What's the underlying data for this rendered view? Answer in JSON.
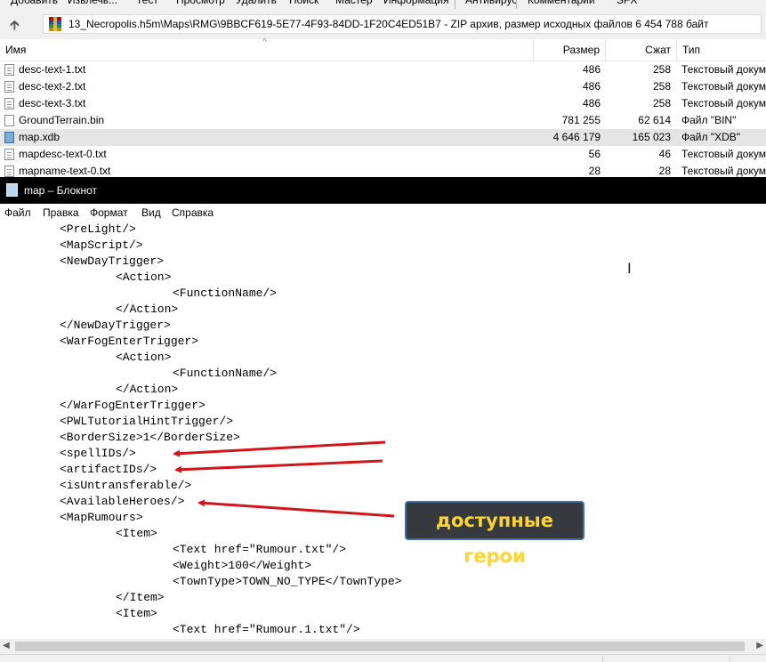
{
  "archiver": {
    "toolbar": [
      "Добавить",
      "Извлечь...",
      "Тест",
      "Просмотр",
      "Удалить",
      "Поиск",
      "Мастер",
      "Информация",
      "Антивирус",
      "Комментарий",
      "SFX"
    ],
    "address": "13_Necropolis.h5m\\Maps\\RMG\\9BBCF619-5E77-4F93-84DD-1F20C4ED51B7 - ZIP архив, размер исходных файлов 6 454 788 байт",
    "up_icon": "up-arrow-icon",
    "columns": {
      "name": "Имя",
      "size": "Размер",
      "packed": "Сжат",
      "type": "Тип"
    },
    "files": [
      {
        "name": "desc-text-1.txt",
        "size": "486",
        "packed": "258",
        "type": "Текстовый докум",
        "icon": "text-file-icon"
      },
      {
        "name": "desc-text-2.txt",
        "size": "486",
        "packed": "258",
        "type": "Текстовый докум",
        "icon": "text-file-icon"
      },
      {
        "name": "desc-text-3.txt",
        "size": "486",
        "packed": "258",
        "type": "Текстовый докум",
        "icon": "text-file-icon"
      },
      {
        "name": "GroundTerrain.bin",
        "size": "781 255",
        "packed": "62 614",
        "type": "Файл \"BIN\"",
        "icon": "file-icon"
      },
      {
        "name": "map.xdb",
        "size": "4 646 179",
        "packed": "165 023",
        "type": "Файл \"XDB\"",
        "icon": "xdb-file-icon",
        "selected": true
      },
      {
        "name": "mapdesc-text-0.txt",
        "size": "56",
        "packed": "46",
        "type": "Текстовый докум",
        "icon": "text-file-icon"
      },
      {
        "name": "mapname-text-0.txt",
        "size": "28",
        "packed": "28",
        "type": "Текстовый докум",
        "icon": "text-file-icon"
      }
    ]
  },
  "notepad": {
    "title": "map – Блокнот",
    "icon": "notepad-icon",
    "menu": [
      "Файл",
      "Правка",
      "Формат",
      "Вид",
      "Справка"
    ],
    "lines": [
      {
        "indent": 1,
        "text": "<PreLight/>"
      },
      {
        "indent": 1,
        "text": "<MapScript/>"
      },
      {
        "indent": 1,
        "text": "<NewDayTrigger>"
      },
      {
        "indent": 2,
        "text": "<Action>"
      },
      {
        "indent": 3,
        "text": "<FunctionName/>"
      },
      {
        "indent": 2,
        "text": "</Action>"
      },
      {
        "indent": 1,
        "text": "</NewDayTrigger>"
      },
      {
        "indent": 1,
        "text": "<WarFogEnterTrigger>"
      },
      {
        "indent": 2,
        "text": "<Action>"
      },
      {
        "indent": 3,
        "text": "<FunctionName/>"
      },
      {
        "indent": 2,
        "text": "</Action>"
      },
      {
        "indent": 1,
        "text": "</WarFogEnterTrigger>"
      },
      {
        "indent": 1,
        "text": "<PWLTutorialHintTrigger/>"
      },
      {
        "indent": 1,
        "text": "<BorderSize>1</BorderSize>"
      },
      {
        "indent": 1,
        "text": "<spellIDs/>"
      },
      {
        "indent": 1,
        "text": "<artifactIDs/>"
      },
      {
        "indent": 1,
        "text": "<isUntransferable/>"
      },
      {
        "indent": 1,
        "text": "<AvailableHeroes/>"
      },
      {
        "indent": 1,
        "text": "<MapRumours>"
      },
      {
        "indent": 2,
        "text": "<Item>"
      },
      {
        "indent": 3,
        "text": "<Text href=\"Rumour.txt\"/>"
      },
      {
        "indent": 3,
        "text": "<Weight>100</Weight>"
      },
      {
        "indent": 3,
        "text": "<TownType>TOWN_NO_TYPE</TownType>"
      },
      {
        "indent": 2,
        "text": "</Item>"
      },
      {
        "indent": 2,
        "text": "<Item>"
      },
      {
        "indent": 3,
        "text": "<Text href=\"Rumour.1.txt\"/>"
      }
    ]
  },
  "annotation": {
    "callout_text": "доступные герои",
    "arrow_color": "#d0151b",
    "callout_bg": "#363a3e",
    "callout_text_color": "#ffd431"
  }
}
